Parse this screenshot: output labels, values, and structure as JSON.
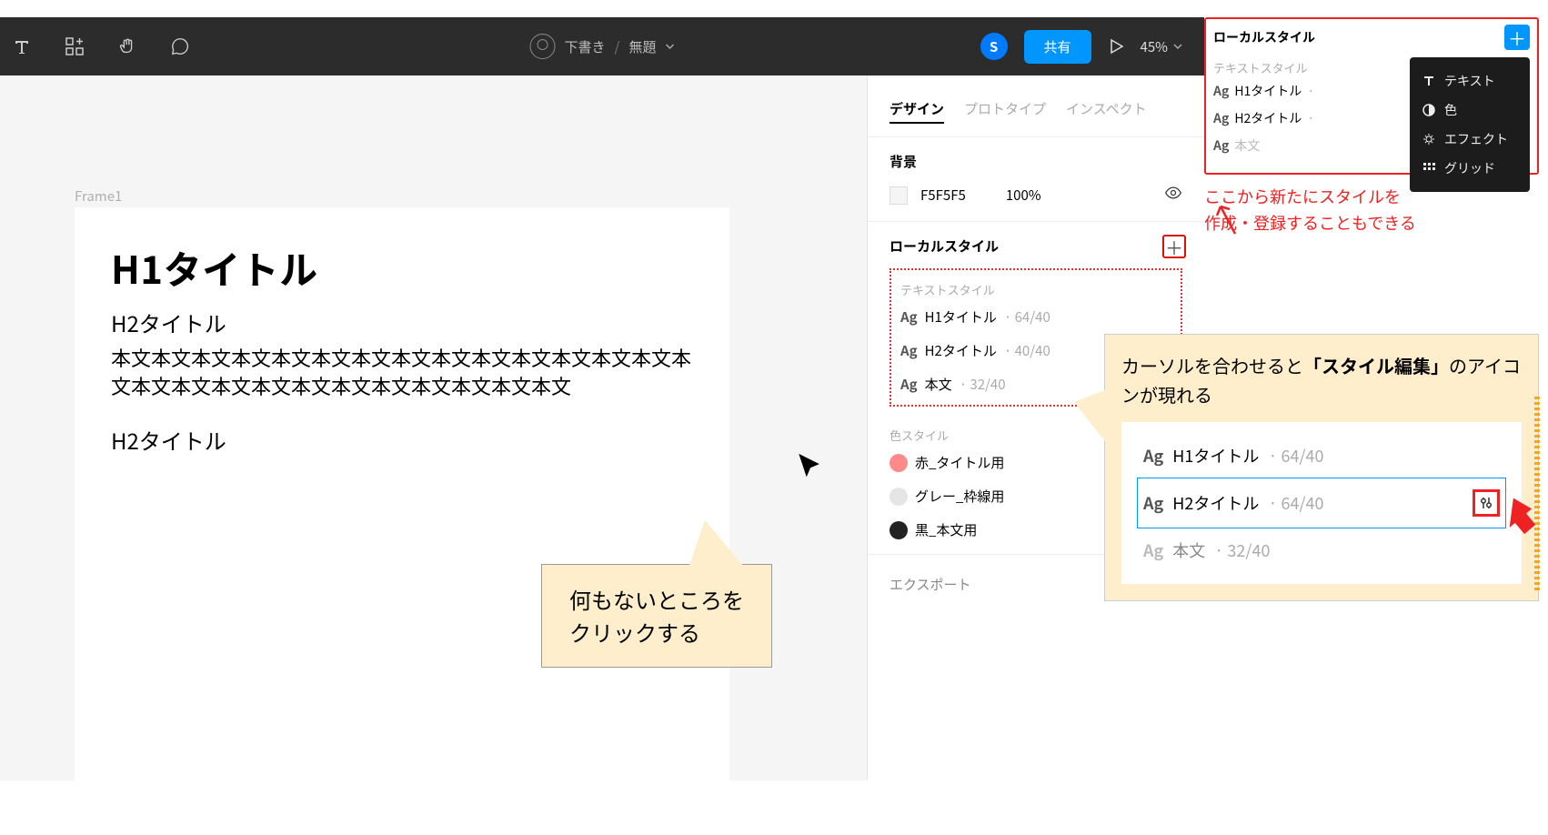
{
  "topbar": {
    "draft_label": "下書き",
    "doc_title": "無題",
    "user_initial": "S",
    "share_label": "共有",
    "zoom": "45%"
  },
  "canvas": {
    "frame_label": "Frame1",
    "h1": "H1タイトル",
    "h2a": "H2タイトル",
    "body": "本文本文本文本文本文本文本文本文本文本文本文本文本文本文本文本文本文本文本文本文本文本文本文本文本文本文",
    "h2b": "H2タイトル"
  },
  "callout1": {
    "line1": "何もないところを",
    "line2": "クリックする"
  },
  "rightpanel": {
    "tabs": {
      "design": "デザイン",
      "prototype": "プロトタイプ",
      "inspect": "インスペクト"
    },
    "bg_title": "背景",
    "bg_color": "F5F5F5",
    "bg_opacity": "100%",
    "local_title": "ローカルスタイル",
    "text_label": "テキストスタイル",
    "h1": {
      "name": "H1タイトル",
      "meta": "· 64/40"
    },
    "h2": {
      "name": "H2タイトル",
      "meta": "· 40/40"
    },
    "body": {
      "name": "本文",
      "meta": "· 32/40"
    },
    "color_label": "色スタイル",
    "red": "赤_タイトル用",
    "grey": "グレー_枠線用",
    "black": "黒_本文用",
    "export": "エクスポート"
  },
  "popover": {
    "title": "ローカルスタイル",
    "sublabel": "テキストスタイル",
    "rows": {
      "h1": "H1タイトル",
      "h2": "H2タイトル",
      "bodyprefix": "本文"
    },
    "menu": {
      "text": "テキスト",
      "color": "色",
      "effect": "エフェクト",
      "grid": "グリッド"
    },
    "caption1": "ここから新たにスタイルを",
    "caption2": "作成・登録することもできる"
  },
  "callout2": {
    "pre": "カーソルを合わせると",
    "bold": "「スタイル編集」",
    "post": "のアイコンが現れる",
    "h1": {
      "name": "H1タイトル",
      "meta": "· 64/40"
    },
    "h2": {
      "name": "H2タイトル",
      "meta": "· 64/40"
    },
    "body": {
      "name": "本文",
      "meta": "· 32/40"
    },
    "ag": "Ag"
  },
  "ag": "Ag"
}
